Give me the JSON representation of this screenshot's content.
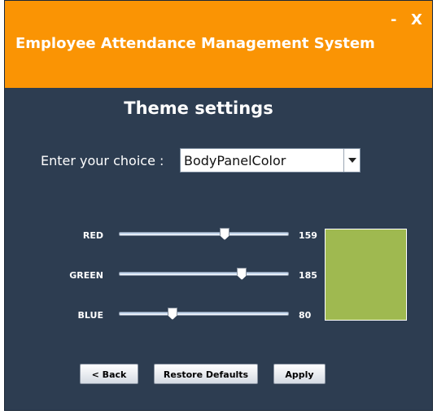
{
  "window": {
    "title": "Employee Attendance Management System",
    "minimize_label": "-",
    "close_label": "X"
  },
  "theme": {
    "heading": "Theme settings",
    "choice_label": "Enter your choice :",
    "choice_value": "BodyPanelColor"
  },
  "sliders": {
    "red": {
      "label": "RED",
      "value": "159"
    },
    "green": {
      "label": "GREEN",
      "value": "185"
    },
    "blue": {
      "label": "BLUE",
      "value": "80"
    }
  },
  "preview_color": "#9fb950",
  "colors": {
    "titlebar": "#fa9404",
    "panel": "#2d3d51"
  },
  "buttons": {
    "back": "< Back",
    "restore": "Restore Defaults",
    "apply": "Apply"
  }
}
